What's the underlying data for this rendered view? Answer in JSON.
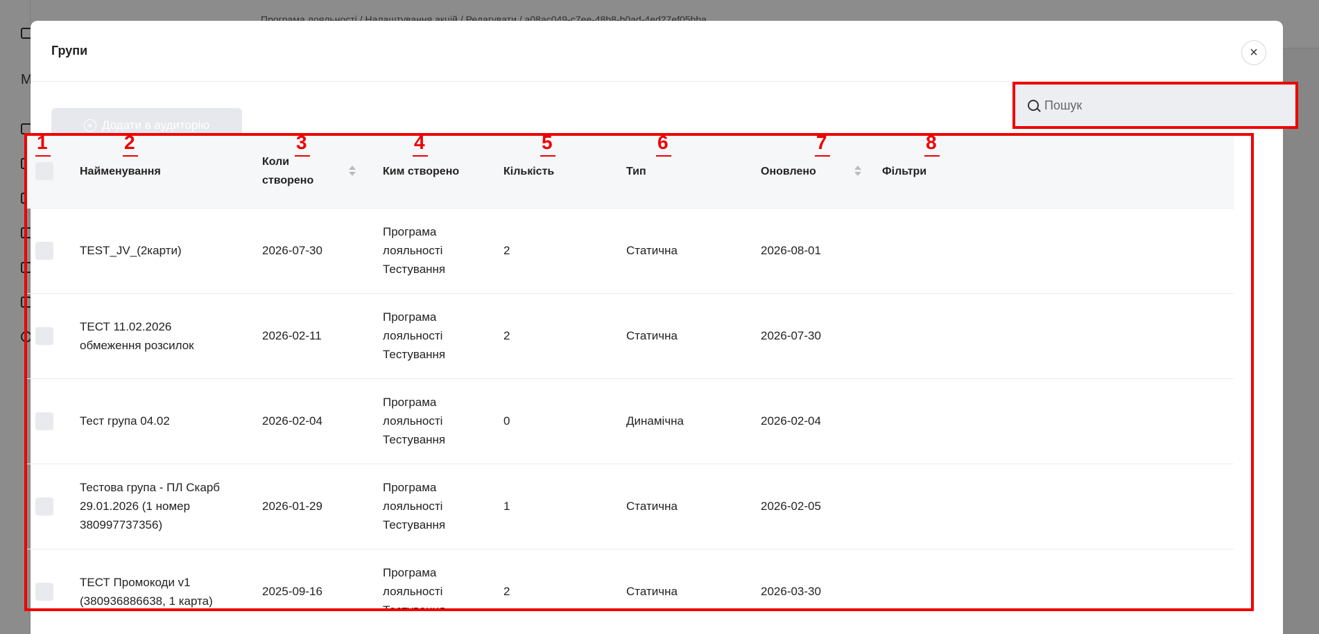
{
  "background": {
    "breadcrumb": "Програма лояльності / Налаштування акцій / Редагувати / a08ac049-c7ee-48b8-b0ad-4ed27ef05bba",
    "sidebar_letter": "М"
  },
  "modal": {
    "title": "Групи",
    "close_label": "×"
  },
  "toolbar": {
    "add_label": "Додати в аудиторію",
    "search_placeholder": "Пошук"
  },
  "table": {
    "headers": {
      "name": "Найменування",
      "created_line1": "Коли",
      "created_line2": "створено",
      "created_by": "Ким створено",
      "count": "Кількість",
      "type": "Тип",
      "updated": "Оновлено",
      "filters": "Фільтри"
    },
    "column_numbers": [
      "1",
      "2",
      "3",
      "4",
      "5",
      "6",
      "7",
      "8"
    ],
    "rows": [
      {
        "name1": "TEST_JV_(2карти)",
        "name2": "",
        "name3": "",
        "created": "2026-07-30",
        "by1": "Програма",
        "by2": "лояльності",
        "by3": "Тестування",
        "count": "2",
        "type": "Статична",
        "updated": "2026-08-01"
      },
      {
        "name1": "ТЕСТ 11.02.2026",
        "name2": "обмеження розсилок",
        "name3": "",
        "created": "2026-02-11",
        "by1": "Програма",
        "by2": "лояльності",
        "by3": "Тестування",
        "count": "2",
        "type": "Статична",
        "updated": "2026-07-30"
      },
      {
        "name1": "Тест група 04.02",
        "name2": "",
        "name3": "",
        "created": "2026-02-04",
        "by1": "Програма",
        "by2": "лояльності",
        "by3": "Тестування",
        "count": "0",
        "type": "Динамічна",
        "updated": "2026-02-04"
      },
      {
        "name1": "Тестова група - ПЛ Скарб",
        "name2": "29.01.2026 (1 номер",
        "name3": "380997737356)",
        "created": "2026-01-29",
        "by1": "Програма",
        "by2": "лояльності",
        "by3": "Тестування",
        "count": "1",
        "type": "Статична",
        "updated": "2026-02-05"
      },
      {
        "name1": "ТЕСТ Промокоди v1",
        "name2": "(380936886638, 1 карта)",
        "name3": "",
        "created": "2025-09-16",
        "by1": "Програма",
        "by2": "лояльності",
        "by3": "Тестування",
        "count": "2",
        "type": "Статична",
        "updated": "2026-03-30"
      }
    ]
  },
  "colors": {
    "highlight": "#ee0000",
    "disabled_button": "#e6e8ed"
  }
}
